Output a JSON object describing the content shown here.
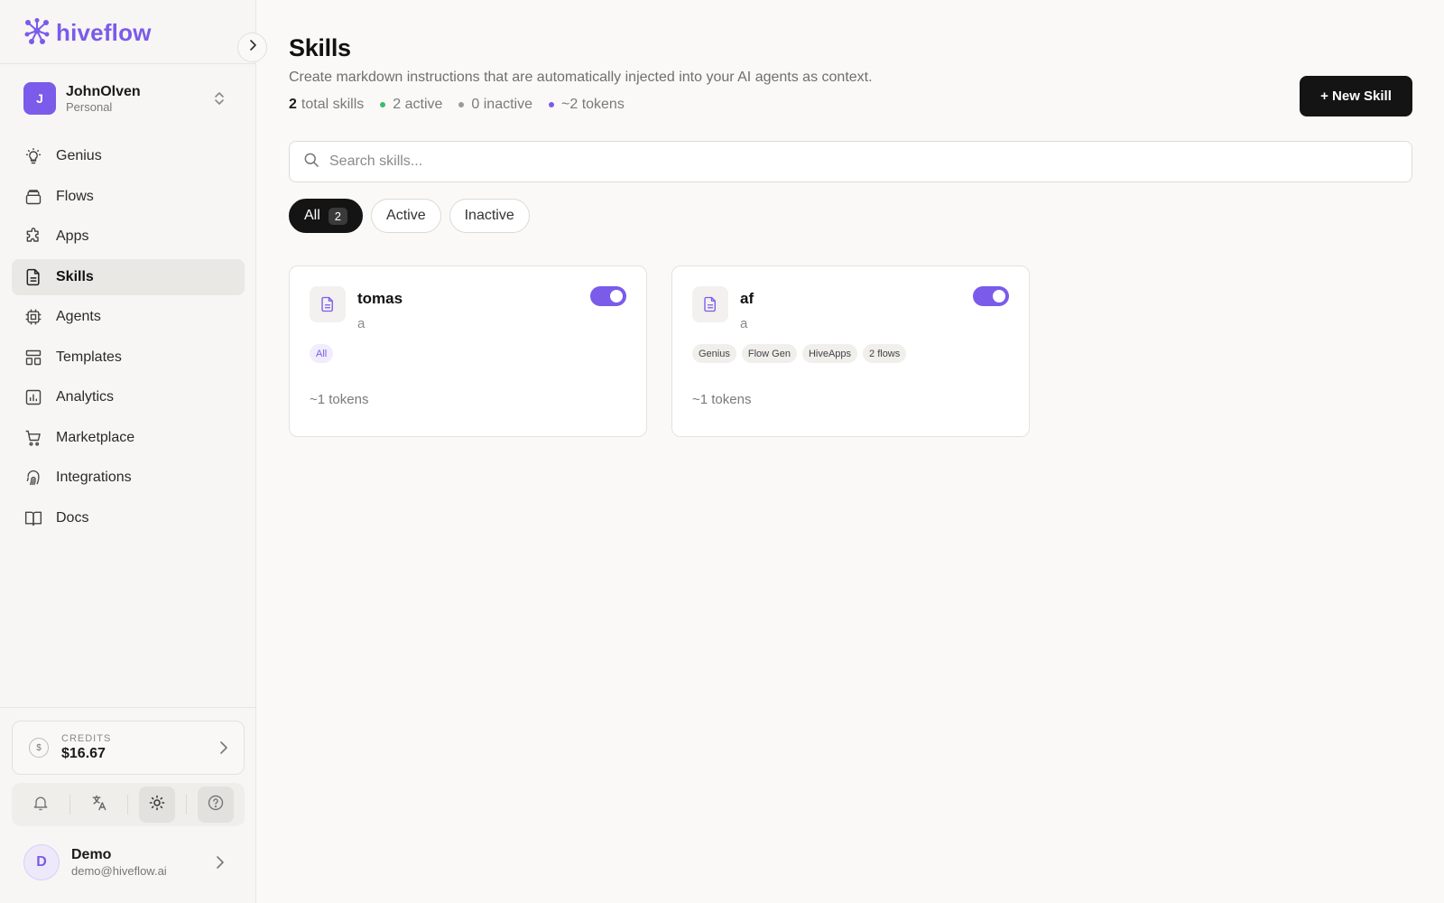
{
  "colors": {
    "accent": "#7a5bea",
    "active_dot": "#3dbb6b",
    "inactive_dot": "#9a9a9a",
    "dark": "#141414"
  },
  "brand": {
    "name": "hiveflow",
    "icon": "hive-logo-icon"
  },
  "workspace": {
    "initial": "J",
    "name": "JohnOlven",
    "type": "Personal"
  },
  "nav": [
    {
      "label": "Genius",
      "icon": "lightbulb-icon",
      "active": false
    },
    {
      "label": "Flows",
      "icon": "layers-icon",
      "active": false
    },
    {
      "label": "Apps",
      "icon": "puzzle-icon",
      "active": false
    },
    {
      "label": "Skills",
      "icon": "document-icon",
      "active": true
    },
    {
      "label": "Agents",
      "icon": "cpu-icon",
      "active": false
    },
    {
      "label": "Templates",
      "icon": "layout-icon",
      "active": false
    },
    {
      "label": "Analytics",
      "icon": "bar-chart-icon",
      "active": false
    },
    {
      "label": "Marketplace",
      "icon": "cart-icon",
      "active": false
    },
    {
      "label": "Integrations",
      "icon": "fingerprint-icon",
      "active": false
    },
    {
      "label": "Docs",
      "icon": "book-icon",
      "active": false
    }
  ],
  "credits": {
    "label": "CREDITS",
    "value": "$16.67",
    "icon": "dollar-circle-icon"
  },
  "toolbar": {
    "icons": [
      "bell-icon",
      "translate-icon",
      "sun-icon",
      "help-circle-icon"
    ]
  },
  "user": {
    "initial": "D",
    "name": "Demo",
    "email": "demo@hiveflow.ai"
  },
  "page": {
    "title": "Skills",
    "subtitle": "Create markdown instructions that are automatically injected into your AI agents as context.",
    "stats": {
      "total_num": "2",
      "total_label": "total skills",
      "active": "2 active",
      "inactive": "0 inactive",
      "tokens": "~2 tokens"
    },
    "new_button": "+ New Skill"
  },
  "search": {
    "placeholder": "Search skills...",
    "value": ""
  },
  "filters": {
    "all": "All",
    "all_count": "2",
    "active": "Active",
    "inactive": "Inactive"
  },
  "skills": [
    {
      "name": "tomas",
      "description": "a",
      "enabled": true,
      "tags": [
        "All"
      ],
      "tokens": "~1 tokens"
    },
    {
      "name": "af",
      "description": "a",
      "enabled": true,
      "tags": [
        "Genius",
        "Flow Gen",
        "HiveApps",
        "2 flows"
      ],
      "tokens": "~1 tokens"
    }
  ]
}
